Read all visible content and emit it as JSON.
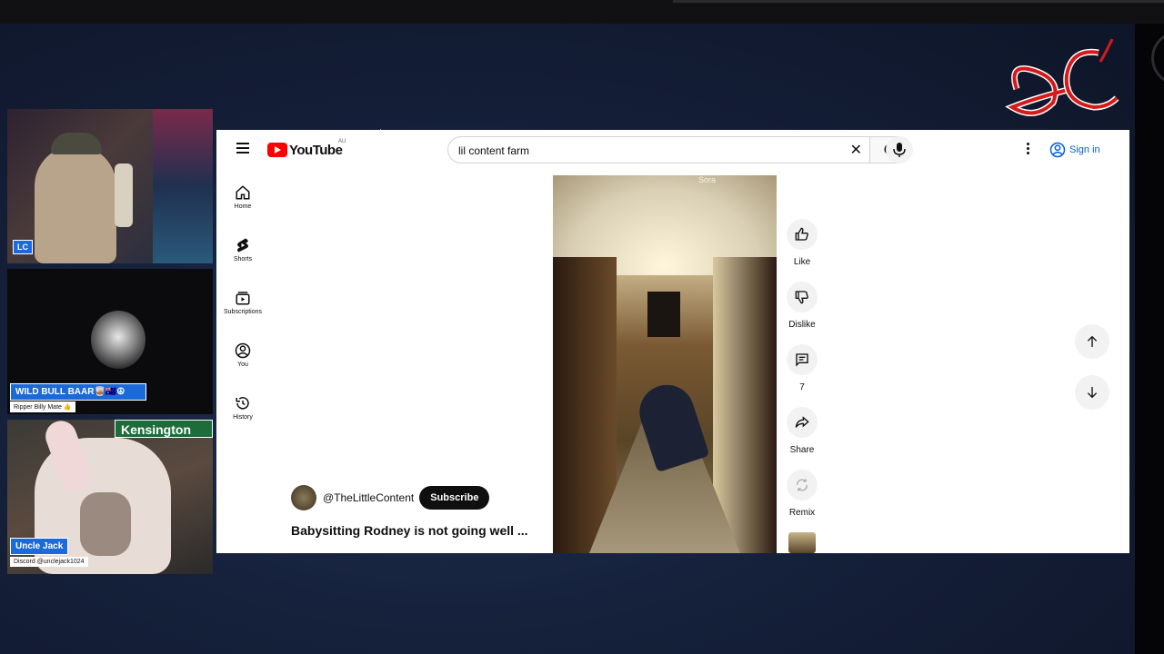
{
  "overlay": {
    "cam1_label": "LC",
    "cam2_label": "WILD BULL BAAR🥃🇦🇺☮",
    "cam2_sub": "Ripper Billy Mate 👍",
    "cam3_label": "Uncle Jack",
    "cam3_sub": "Discord @unclejack1024",
    "cam3_sign": "Kensington",
    "logo_text": "LC"
  },
  "youtube": {
    "logo_word": "YouTube",
    "logo_region": "AU",
    "search": {
      "value": "lil content farm",
      "placeholder": "Search"
    },
    "signin_label": "Sign in",
    "sidebar": {
      "items": [
        {
          "label": "Home",
          "icon": "home-icon"
        },
        {
          "label": "Shorts",
          "icon": "shorts-icon"
        },
        {
          "label": "Subscriptions",
          "icon": "subscriptions-icon"
        },
        {
          "label": "You",
          "icon": "you-icon"
        },
        {
          "label": "History",
          "icon": "history-icon"
        }
      ]
    },
    "short": {
      "channel_handle": "@TheLittleContent",
      "subscribe_label": "Subscribe",
      "title": "Babysitting Rodney is not going well ...",
      "watermark": "Sora"
    },
    "actions": {
      "like_label": "Like",
      "dislike_label": "Dislike",
      "comments_count": "7",
      "share_label": "Share",
      "remix_label": "Remix"
    }
  },
  "colors": {
    "youtube_red": "#ff0000",
    "link_blue": "#065fd4",
    "label_blue": "#1b6ad8",
    "sign_green": "#1d6d3b",
    "logo_red": "#d41a1a"
  }
}
